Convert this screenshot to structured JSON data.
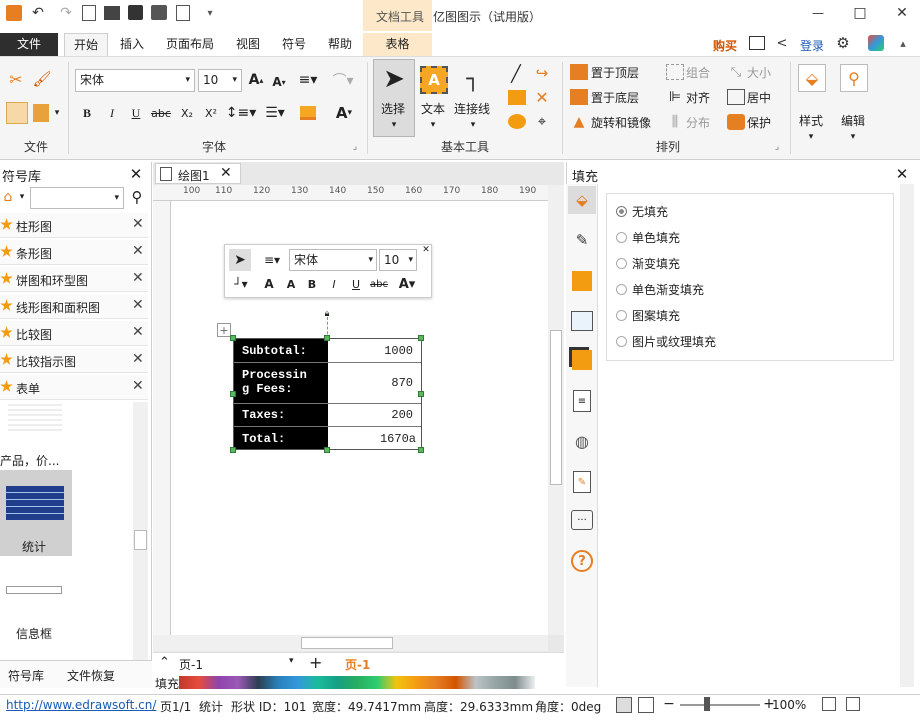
{
  "titlebar": {
    "context_tab": "文档工具",
    "app_title": "亿图图示（试用版）",
    "min": "—",
    "max": "□",
    "close": "✕"
  },
  "tabs": [
    "文件",
    "开始",
    "插入",
    "页面布局",
    "视图",
    "符号",
    "帮助",
    "表格"
  ],
  "account": {
    "buy": "购买",
    "login": "登录"
  },
  "ribbon": {
    "font_name": "宋体",
    "font_size": "10",
    "groups": {
      "file": "文件",
      "font": "字体",
      "basic": "基本工具",
      "arrange": "排列"
    },
    "select": "选择",
    "text": "文本",
    "connector": "连接线",
    "arrange_items": [
      "置于顶层",
      "置于底层",
      "旋转和镜像",
      "组合",
      "对齐",
      "分布",
      "大小",
      "居中",
      "保护"
    ],
    "style": "样式",
    "edit": "编辑"
  },
  "left_panel": {
    "title": "符号库",
    "libraries": [
      "柱形图",
      "条形图",
      "饼图和环型图",
      "线形图和面积图",
      "比较图",
      "比较指示图",
      "表单"
    ],
    "shape_label_1": "产品，价...",
    "shape_label_2": "统计",
    "shape_label_3": "信息框",
    "tab_symbols": "符号库",
    "tab_recover": "文件恢复"
  },
  "document": {
    "tab": "绘图1",
    "ruler_h": [
      "100",
      "110",
      "120",
      "130",
      "140",
      "150",
      "160",
      "170",
      "180",
      "190"
    ],
    "ruler_v": [
      "50",
      "60",
      "70",
      "80",
      "90",
      "100",
      "110",
      "120",
      "130",
      "140",
      "150",
      "160",
      "170",
      "180",
      "190"
    ],
    "mini_toolbar": {
      "font": "宋体",
      "size": "10"
    },
    "table_rows": [
      {
        "label": "Subtotal:",
        "value": "1000"
      },
      {
        "label": "Processin\ng Fees:",
        "value": "870"
      },
      {
        "label": "Taxes:",
        "value": "200"
      },
      {
        "label": "Total:",
        "value": "1670a"
      }
    ],
    "page_tab_left": "页-1",
    "page_tab_active": "页-1",
    "fill_label": "填充"
  },
  "right_panel": {
    "title": "填充",
    "options": [
      "无填充",
      "单色填充",
      "渐变填充",
      "单色渐变填充",
      "图案填充",
      "图片或纹理填充"
    ]
  },
  "status": {
    "url": "http://www.edrawsoft.cn/",
    "page": "页1/1",
    "stats": "统计",
    "shape_id": "形状 ID：101",
    "width": "宽度：49.7417mm",
    "height": "高度：29.6333mm",
    "angle": "角度：0deg",
    "zoom": "100%"
  }
}
